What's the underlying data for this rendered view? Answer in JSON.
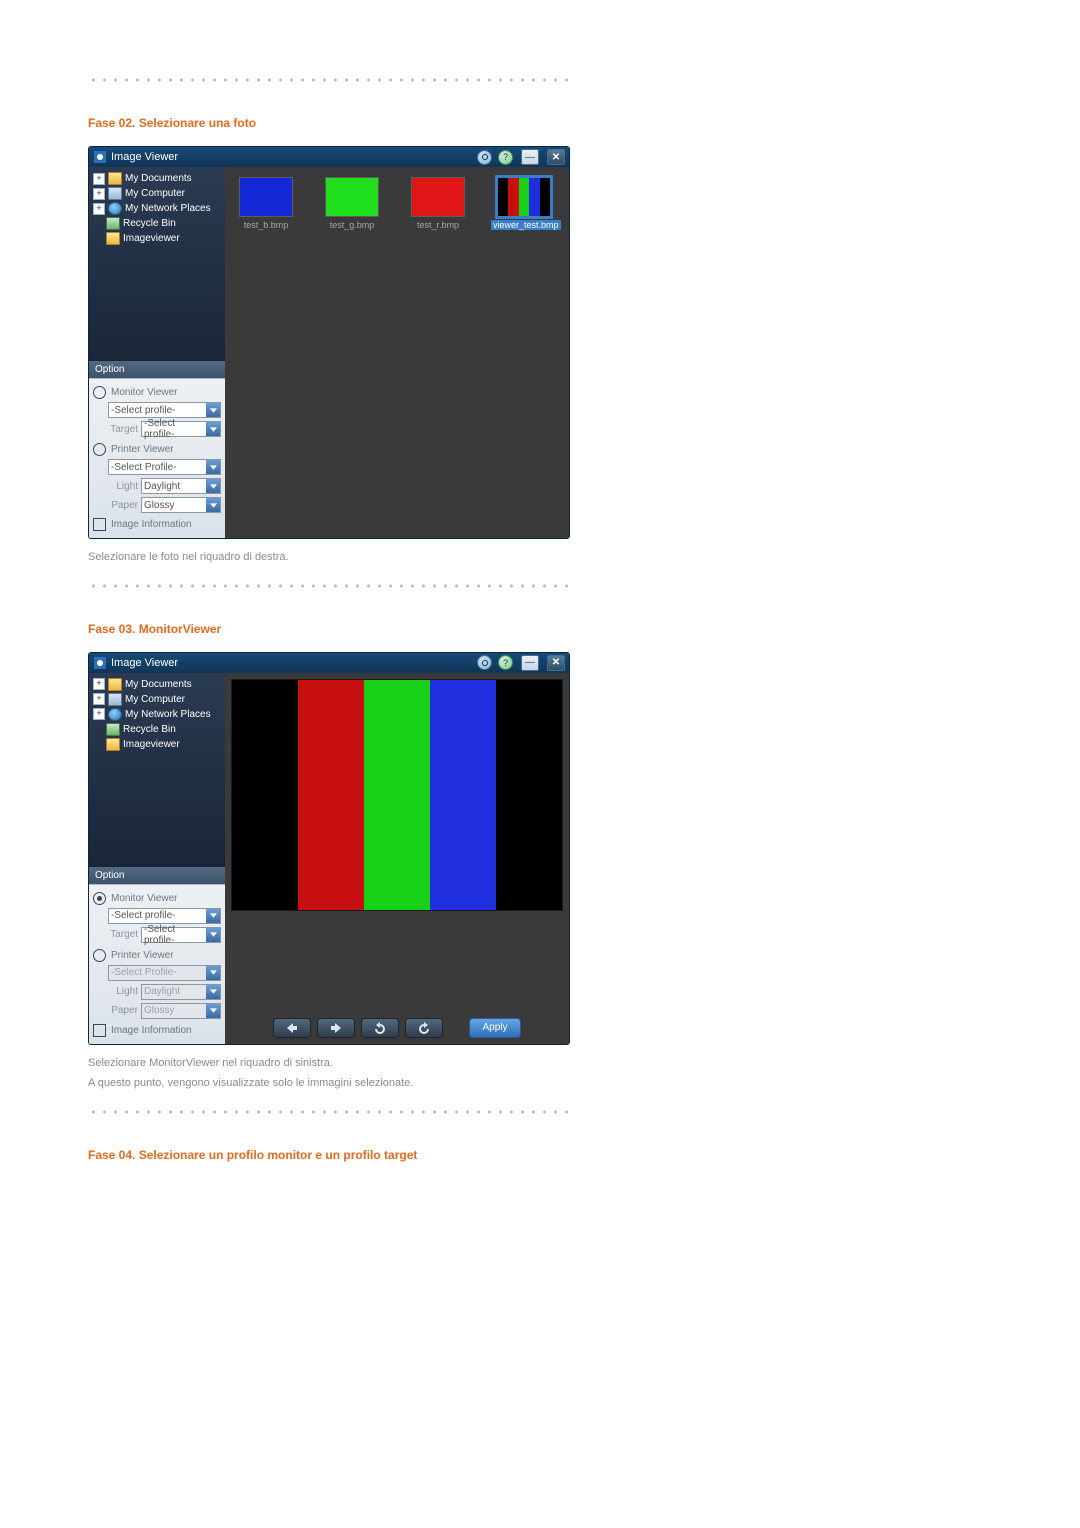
{
  "section02": {
    "title": "Fase 02. Selezionare una foto",
    "caption": "Selezionare le foto nel riquadro di destra."
  },
  "section03": {
    "title": "Fase 03. MonitorViewer",
    "caption1": "Selezionare MonitorViewer nel riquadro di sinistra.",
    "caption2": "A questo punto, vengono visualizzate solo le immagini selezionate."
  },
  "section04": {
    "title": "Fase 04. Selezionare un profilo monitor e un profilo target"
  },
  "app": {
    "title": "Image Viewer"
  },
  "tree": {
    "items": [
      {
        "label": "My Documents"
      },
      {
        "label": "My Computer"
      },
      {
        "label": "My Network Places"
      },
      {
        "label": "Recycle Bin"
      },
      {
        "label": "Imageviewer"
      }
    ]
  },
  "option_header": "Option",
  "panel": {
    "monitor_viewer": "Monitor Viewer",
    "printer_viewer": "Printer Viewer",
    "select_profile": "-Select profile-",
    "select_profile2": "-Select Profile-",
    "target_label": "Target",
    "light_label": "Light",
    "paper_label": "Paper",
    "light_value": "Daylight",
    "paper_value": "Glossy",
    "image_info": "Image Information"
  },
  "thumbs": {
    "files": [
      {
        "name": "test_b.bmp",
        "color": "#1428d8"
      },
      {
        "name": "test_g.bmp",
        "color": "#1ede1e"
      },
      {
        "name": "test_r.bmp",
        "color": "#e01616"
      }
    ],
    "selected": {
      "name": "viewer_test.bmp"
    }
  },
  "colorBars": [
    "#000000",
    "#c80f0f",
    "#17d117",
    "#1f2fe0",
    "#000000"
  ],
  "apply": "Apply"
}
